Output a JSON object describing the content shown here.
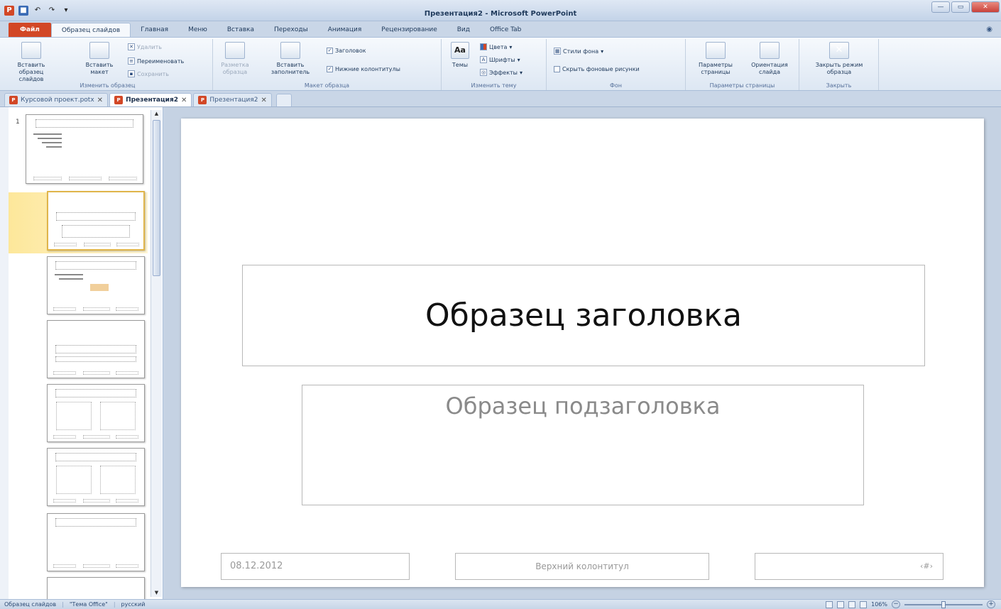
{
  "window": {
    "title": "Презентация2 - Microsoft PowerPoint",
    "buttons": {
      "minimize": "—",
      "maximize": "▭",
      "close": "✕"
    }
  },
  "ribbon_tabs": [
    {
      "label": "Файл"
    },
    {
      "label": "Образец слайдов"
    },
    {
      "label": "Главная"
    },
    {
      "label": "Меню"
    },
    {
      "label": "Вставка"
    },
    {
      "label": "Переходы"
    },
    {
      "label": "Анимация"
    },
    {
      "label": "Рецензирование"
    },
    {
      "label": "Вид"
    },
    {
      "label": "Office Tab"
    }
  ],
  "ribbon": {
    "g1": {
      "label": "Изменить образец",
      "insert_master": "Вставить образец слайдов",
      "insert_layout": "Вставить макет",
      "delete": "Удалить",
      "rename": "Переименовать",
      "save": "Сохранить"
    },
    "g2": {
      "label": "Макет образца",
      "markup": "Разметка образца",
      "insert_placeholder": "Вставить заполнитель",
      "title_check": "Заголовок",
      "footers_check": "Нижние колонтитулы"
    },
    "g3": {
      "label": "Изменить тему",
      "themes": "Темы",
      "colors": "Цвета",
      "fonts": "Шрифты",
      "effects": "Эффекты"
    },
    "g4": {
      "label": "Фон",
      "bg_styles": "Стили фона",
      "hide_bg": "Скрыть фоновые рисунки"
    },
    "g5": {
      "label": "Параметры страницы",
      "page_setup": "Параметры страницы",
      "orientation": "Ориентация слайда"
    },
    "g6": {
      "label": "Закрыть",
      "close_master": "Закрыть режим образца"
    }
  },
  "doc_tabs": [
    {
      "label": "Курсовой проект.potx"
    },
    {
      "label": "Презентация2"
    },
    {
      "label": "Презентация2"
    }
  ],
  "thumbnails": {
    "slide_number": "1"
  },
  "slide": {
    "title": "Образец заголовка",
    "subtitle": "Образец подзаголовка",
    "date": "08.12.2012",
    "footer": "Верхний колонтитул",
    "number": "‹#›"
  },
  "statusbar": {
    "mode": "Образец слайдов",
    "theme": "\"Тема Office\"",
    "language": "русский",
    "zoom": "106%"
  }
}
